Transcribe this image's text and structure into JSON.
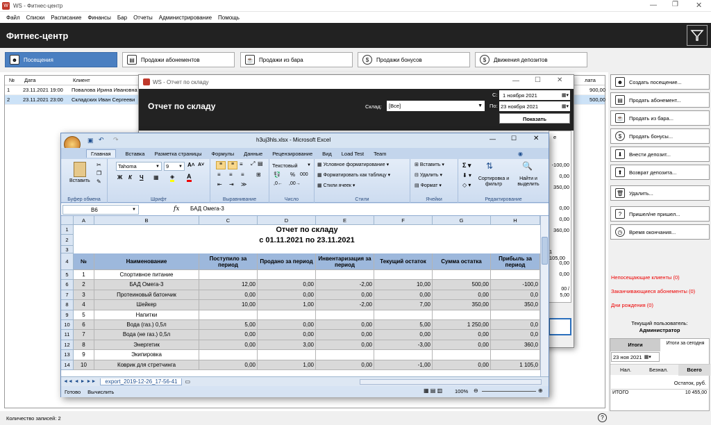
{
  "window": {
    "title": "WS - Фитнес-центр"
  },
  "menu": [
    "Файл",
    "Списки",
    "Расписание",
    "Финансы",
    "Бар",
    "Отчеты",
    "Администрирование",
    "Помощь"
  ],
  "header": {
    "title": "Фитнес-центр"
  },
  "tabs": [
    {
      "label": "Посещения",
      "icon": "person-icon"
    },
    {
      "label": "Продажи абонементов",
      "icon": "ticket-icon"
    },
    {
      "label": "Продажи из бара",
      "icon": "cup-icon"
    },
    {
      "label": "Продажи бонусов",
      "icon": "dollar-icon"
    },
    {
      "label": "Движения депозитов",
      "icon": "dollar-icon"
    }
  ],
  "grid": {
    "columns": [
      "№",
      "Дата",
      "Клиент",
      "лата"
    ],
    "rows": [
      {
        "n": "1",
        "date": "23.11.2021 19:00",
        "client": "Повалова Ирина Ивановна",
        "amount": "900,00"
      },
      {
        "n": "2",
        "date": "23.11.2021 23:00",
        "client": "Складских Иван Сергееви",
        "amount": "500,00"
      }
    ]
  },
  "right_panel": {
    "buttons": [
      {
        "label": "Создать посещение...",
        "icon": "person-icon"
      },
      {
        "label": "Продать абонемент...",
        "icon": "ticket-icon"
      },
      {
        "label": "Продать из бара...",
        "icon": "cup-icon"
      },
      {
        "label": "Продать бонусы...",
        "icon": "dollar-icon"
      },
      {
        "label": "Внести депозит...",
        "icon": "deposit-icon"
      },
      {
        "label": "Возврат депозита...",
        "icon": "refund-icon"
      },
      {
        "label": "Удалить...",
        "icon": "trash-icon"
      },
      {
        "label": "Пришел/не пришел...",
        "icon": "question-person-icon"
      },
      {
        "label": "Время окончания...",
        "icon": "clock-icon"
      }
    ],
    "links": [
      "Непосещающие клиенты (0)",
      "Заканчивающиеся абонементы (0)",
      "Дни рождения (0)"
    ],
    "user_label": "Текущий пользователь:",
    "user_name": "Администратор",
    "totals_tab": "Итоги",
    "totals_today_tab": "Итоги за сегодня",
    "date_value": "23 ноя 2021",
    "pay_tabs": [
      "Нал.",
      "Безнал.",
      "Всего"
    ],
    "remainder_header": "Остаток, руб.",
    "total_label": "ИТОГО",
    "total_value": "10 455,00"
  },
  "status": {
    "records": "Количество записей: 2"
  },
  "report": {
    "window_title": "WS - Отчет по складу",
    "title": "Отчет по складу",
    "warehouse_label": "Склад:",
    "warehouse_value": "[Все]",
    "from_label": "С:",
    "from_value": "1  ноября  2021",
    "to_label": "По:",
    "to_value": "23  ноября  2021",
    "show_button": "Показать",
    "side_values": [
      "-100,00",
      "0,00",
      "350,00",
      "0,00",
      "0,00",
      "360,00",
      "1 105,00",
      "0,00",
      "0,00"
    ],
    "side_partial": "е",
    "side_bottom": [
      "00 /",
      "5,00"
    ]
  },
  "excel": {
    "title": "h3uj3hls.xlsx  -  Microsoft Excel",
    "tabs": [
      "Главная",
      "Вставка",
      "Разметка страницы",
      "Формулы",
      "Данные",
      "Рецензирование",
      "Вид",
      "Load Test",
      "Team"
    ],
    "groups": [
      "Буфер обмена",
      "Шрифт",
      "Выравнивание",
      "Число",
      "Стили",
      "Ячейки",
      "Редактирование"
    ],
    "paste": "Вставить",
    "font": "Tahoma",
    "font_size": "9",
    "number_format": "Текстовый",
    "styles": [
      "Условное форматирование",
      "Форматировать как таблицу",
      "Стили ячеек"
    ],
    "cells_cmds": [
      "Вставить",
      "Удалить",
      "Формат"
    ],
    "sort": "Сортировка и фильтр",
    "find": "Найти и выделить",
    "name_box": "B6",
    "formula": "БАД Омега-3",
    "col_letters": [
      "A",
      "B",
      "C",
      "D",
      "E",
      "F",
      "G",
      "H"
    ],
    "report_title": "Отчет по складу",
    "report_period": "с 01.11.2021 по 23.11.2021",
    "table_headers": [
      "№",
      "Наименование",
      "Поступило за период",
      "Продано за период",
      "Инвентаризация за период",
      "Текущий остаток",
      "Сумма остатка",
      "Прибыль за период"
    ],
    "rows": [
      {
        "r": "5",
        "a": "1",
        "b": "Спортивное питание",
        "cat": true
      },
      {
        "r": "6",
        "a": "2",
        "b": "БАД Омега-3",
        "c": "12,00",
        "d": "0,00",
        "e": "-2,00",
        "f": "10,00",
        "g": "500,00",
        "h": "-100,0"
      },
      {
        "r": "7",
        "a": "3",
        "b": "Протеиновый батончик",
        "c": "0,00",
        "d": "0,00",
        "e": "0,00",
        "f": "0,00",
        "g": "0,00",
        "h": "0,0"
      },
      {
        "r": "8",
        "a": "4",
        "b": "Шейкер",
        "c": "10,00",
        "d": "1,00",
        "e": "-2,00",
        "f": "7,00",
        "g": "350,00",
        "h": "350,0"
      },
      {
        "r": "9",
        "a": "5",
        "b": "Напитки",
        "cat": true
      },
      {
        "r": "10",
        "a": "6",
        "b": "Вода (газ.) 0,5л",
        "c": "5,00",
        "d": "0,00",
        "e": "0,00",
        "f": "5,00",
        "g": "1 250,00",
        "h": "0,0"
      },
      {
        "r": "11",
        "a": "7",
        "b": "Вода (не газ.) 0,5л",
        "c": "0,00",
        "d": "0,00",
        "e": "0,00",
        "f": "0,00",
        "g": "0,00",
        "h": "0,0"
      },
      {
        "r": "12",
        "a": "8",
        "b": "Энергетик",
        "c": "0,00",
        "d": "3,00",
        "e": "0,00",
        "f": "-3,00",
        "g": "0,00",
        "h": "360,0"
      },
      {
        "r": "13",
        "a": "9",
        "b": "Экипировка",
        "cat": true
      },
      {
        "r": "14",
        "a": "10",
        "b": "Коврик для стретчинга",
        "c": "0,00",
        "d": "1,00",
        "e": "0,00",
        "f": "-1,00",
        "g": "0,00",
        "h": "1 105,0"
      }
    ],
    "sheet_tab": "export_2019-12-26_17-56-41",
    "status_ready": "Готово",
    "status_calc": "Вычислить",
    "zoom": "100%"
  }
}
